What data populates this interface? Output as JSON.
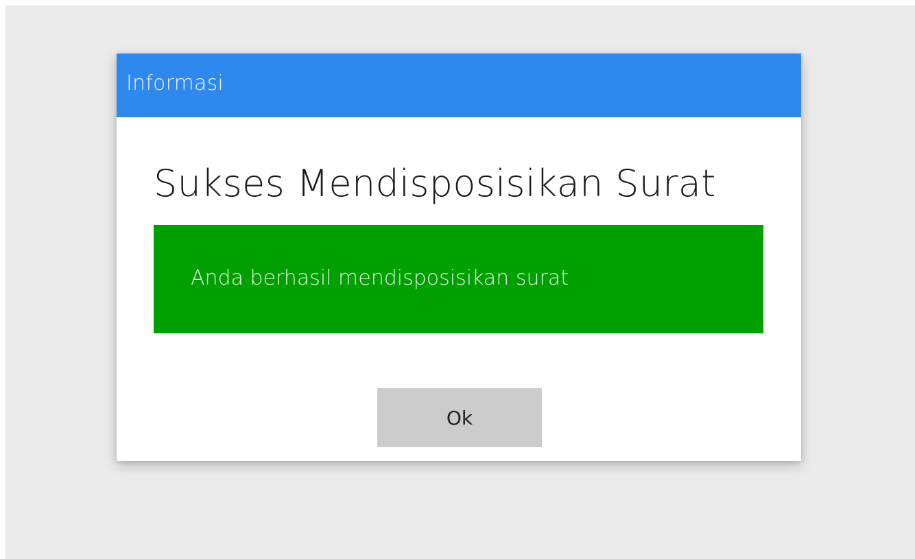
{
  "dialog": {
    "title": "Informasi",
    "heading": "Sukses Mendisposisikan Surat",
    "message": "Anda berhasil mendisposisikan surat",
    "ok_label": "Ok"
  },
  "colors": {
    "titlebar": "#2e88ee",
    "alert_success": "#00a000",
    "button": "#cccccc",
    "backdrop": "#ebebeb"
  }
}
